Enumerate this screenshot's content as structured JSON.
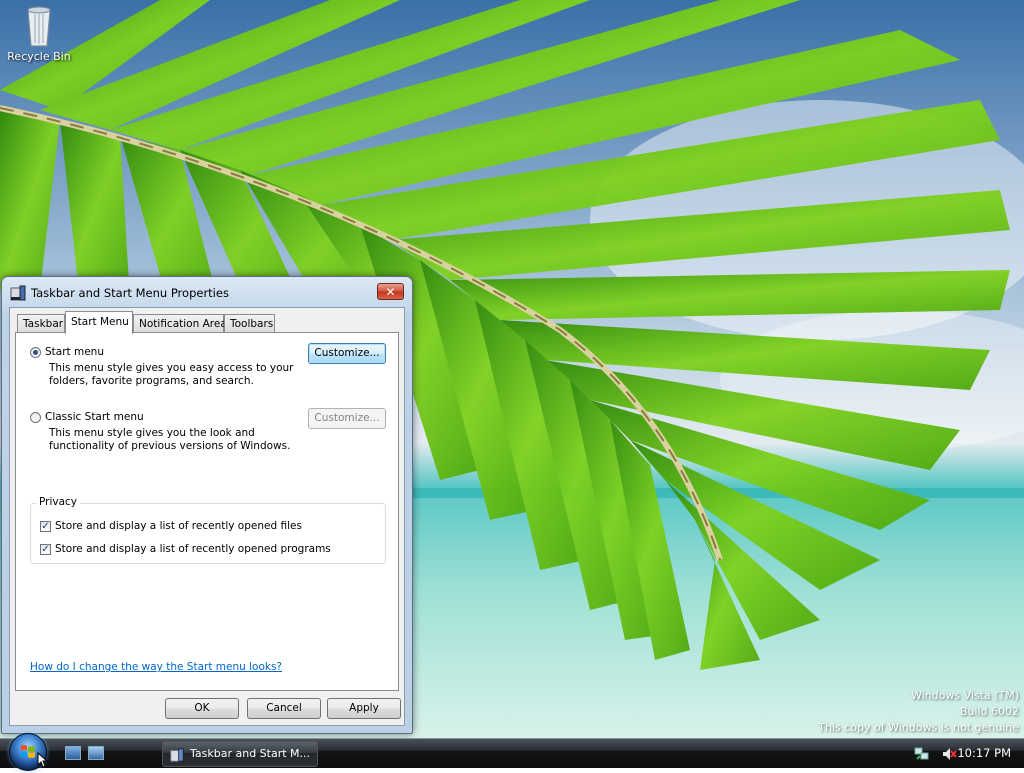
{
  "desktop": {
    "icons": [
      {
        "label": "Recycle Bin",
        "icon": "recycle-bin-icon"
      }
    ],
    "watermark": {
      "line1": "Windows Vista (TM)",
      "line2": "Build 6002",
      "line3": "This copy of Windows is not genuine"
    }
  },
  "dialog": {
    "title": "Taskbar and Start Menu Properties",
    "close_label": "✕",
    "tabs": [
      {
        "label": "Taskbar",
        "active": false
      },
      {
        "label": "Start Menu",
        "active": true
      },
      {
        "label": "Notification Area",
        "active": false
      },
      {
        "label": "Toolbars",
        "active": false
      }
    ],
    "start_menu": {
      "label": "Start menu",
      "checked": true,
      "description": "This menu style gives you easy access to your folders, favorite programs, and search.",
      "customize_label": "Customize..."
    },
    "classic_start_menu": {
      "label": "Classic Start menu",
      "checked": false,
      "description": "This menu style gives you the look and functionality of previous versions of Windows.",
      "customize_label": "Customize..."
    },
    "privacy": {
      "label": "Privacy",
      "options": [
        {
          "label": "Store and display a list of recently opened files",
          "checked": true
        },
        {
          "label": "Store and display a list of recently opened programs",
          "checked": true
        }
      ]
    },
    "help_link": "How do I change the way the Start menu looks?",
    "buttons": {
      "ok": "OK",
      "cancel": "Cancel",
      "apply": "Apply"
    }
  },
  "taskbar": {
    "quick_launch": [
      "show-desktop-icon",
      "switch-windows-icon"
    ],
    "tasks": [
      {
        "label": "Taskbar and Start M...",
        "icon": "taskbar-properties-icon"
      }
    ],
    "tray_icons": [
      "network-icon",
      "volume-muted-icon"
    ],
    "clock": "10:17 PM"
  },
  "colors": {
    "link": "#0066cc",
    "taskbar": "#111315",
    "close_button": "#c0341c",
    "palm_leaf": "#6fc21a"
  }
}
